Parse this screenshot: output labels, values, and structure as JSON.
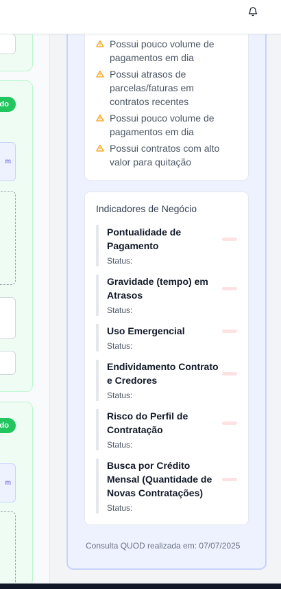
{
  "risk_factors": [
    "Possui pouco volume de pagamentos em dia",
    "Possui atrasos de parcelas/faturas em contratos recentes",
    "Possui pouco volume de pagamentos em dia",
    "Possui contratos com alto valor para quitação"
  ],
  "indicators": {
    "title": "Indicadores de Negócio",
    "items": [
      {
        "name": "Pontualidade de Pagamento",
        "status": "Status:"
      },
      {
        "name": "Gravidade (tempo) em Atrasos",
        "status": "Status:"
      },
      {
        "name": "Uso Emergencial",
        "status": "Status:"
      },
      {
        "name": "Endividamento Contrato e Credores",
        "status": "Status:"
      },
      {
        "name": "Risco do Perfil de Contratação",
        "status": "Status:"
      },
      {
        "name": "Busca por Crédito Mensal (Quantidade de Novas Contratações)",
        "status": "Status:"
      }
    ]
  },
  "footer": "Consulta QUOD realizada em: 07/07/2025",
  "left_partial": {
    "pill_text": "do",
    "box_text": "m"
  },
  "colors": {
    "accent_green": "#22c55e",
    "panel_bg": "#eef2ff",
    "warning": "#f59e0b"
  },
  "icons": {
    "notification": "bell-icon",
    "warning": "warning-triangle-icon"
  }
}
